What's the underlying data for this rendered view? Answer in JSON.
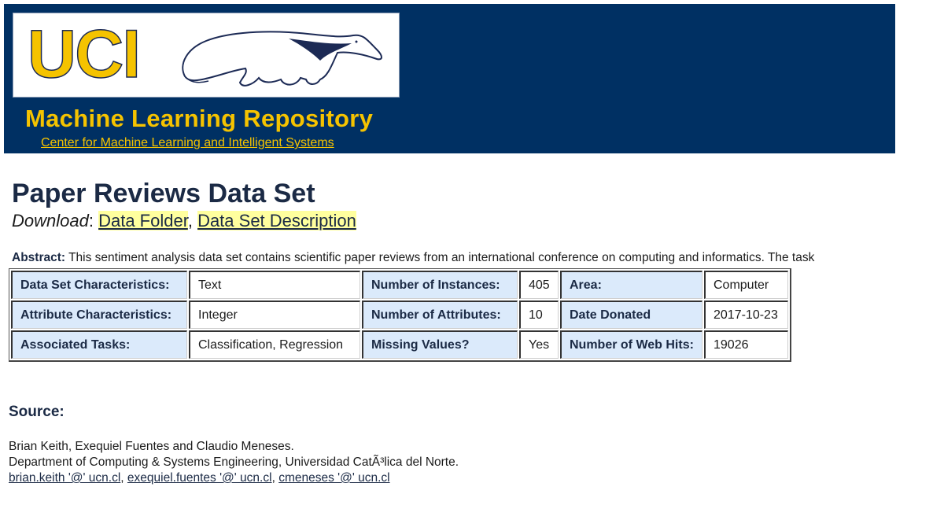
{
  "header": {
    "logo_text": "UCI",
    "logo_mascot": "anteater",
    "repo_title": "Machine Learning Repository",
    "repo_subtitle_link": "Center for Machine Learning and Intelligent Systems",
    "colors": {
      "banner_bg": "#003063",
      "accent_gold": "#f5c300"
    }
  },
  "dataset": {
    "title": "Paper Reviews Data Set",
    "download_label": "Download",
    "download_sep": ":",
    "download_links": [
      "Data Folder",
      "Data Set Description"
    ],
    "abstract_label": "Abstract:",
    "abstract_text": "This sentiment analysis data set contains scientific paper reviews from an international conference on computing and informatics. The task"
  },
  "characteristics": {
    "rows": [
      [
        {
          "label": "Data Set Characteristics:",
          "value": "Text"
        },
        {
          "label": "Number of Instances:",
          "value": "405"
        },
        {
          "label": "Area:",
          "value": "Computer"
        }
      ],
      [
        {
          "label": "Attribute Characteristics:",
          "value": "Integer"
        },
        {
          "label": "Number of Attributes:",
          "value": "10"
        },
        {
          "label": "Date Donated",
          "value": "2017-10-23"
        }
      ],
      [
        {
          "label": "Associated Tasks:",
          "value": "Classification, Regression"
        },
        {
          "label": "Missing Values?",
          "value": "Yes"
        },
        {
          "label": "Number of Web Hits:",
          "value": "19026"
        }
      ]
    ]
  },
  "source": {
    "heading": "Source:",
    "authors": "Brian Keith, Exequiel Fuentes and Claudio Meneses.",
    "affiliation": "Department of Computing & Systems Engineering, Universidad CatÃ³lica del Norte.",
    "emails": [
      "brian.keith '@' ucn.cl",
      "exequiel.fuentes '@' ucn.cl",
      "cmeneses '@' ucn.cl"
    ],
    "email_sep": ", "
  }
}
